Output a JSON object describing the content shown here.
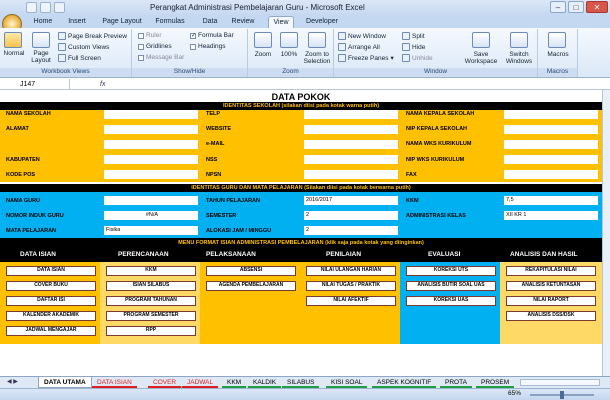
{
  "window": {
    "title": "Perangkat Administrasi Pembelajaran Guru  -  Microsoft Excel",
    "minimize": "–",
    "maximize": "□",
    "close": "✕"
  },
  "ribbon_tabs": [
    "Home",
    "Insert",
    "Page Layout",
    "Formulas",
    "Data",
    "Review",
    "View",
    "Developer"
  ],
  "active_tab": "View",
  "ribbon": {
    "workbook_views": {
      "label": "Workbook Views",
      "normal": "Normal",
      "page_layout": "Page Layout",
      "page_break": "Page Break Preview",
      "custom": "Custom Views",
      "full": "Full Screen"
    },
    "show_hide": {
      "label": "Show/Hide",
      "ruler": "Ruler",
      "gridlines": "Gridlines",
      "message_bar": "Message Bar",
      "formula_bar": "Formula Bar",
      "headings": "Headings"
    },
    "zoom": {
      "label": "Zoom",
      "zoom": "Zoom",
      "pct": "100%",
      "selection": "Zoom to Selection"
    },
    "window": {
      "label": "Window",
      "new_window": "New Window",
      "arrange_all": "Arrange All",
      "freeze": "Freeze Panes",
      "split": "Split",
      "hide": "Hide",
      "unhide": "Unhide",
      "save_ws": "Save Workspace",
      "switch": "Switch Windows"
    },
    "macros": {
      "label": "Macros",
      "macros": "Macros"
    }
  },
  "formula_bar": {
    "name_box": "J147",
    "fx": "fx"
  },
  "sheet": {
    "title": "DATA POKOK",
    "identitas_sekolah": "IDENTITAS SEKOLAH (silakan diisi pada kotak warna putih)",
    "school_fields": {
      "nama_sekolah": "NAMA SEKOLAH",
      "alamat": "ALAMAT",
      "kabupaten": "KABUPATEN",
      "kode_pos": "KODE POS",
      "telp": "TELP",
      "website": "WEBSITE",
      "email": "e-MAIL",
      "nss": "NSS",
      "npsn": "NPSN",
      "nama_kepala": "NAMA KEPALA SEKOLAH",
      "nip_kepala": "NIP KEPALA SEKOLAH",
      "nama_wks": "NAMA WKS KURIKULUM",
      "nip_wks": "NIP WKS KURIKULUM",
      "fax": "FAX"
    },
    "identitas_guru": "IDENTITAS GURU DAN MATA PELAJARAN (Silakan diisi pada kotak berwarna putih)",
    "guru_fields": {
      "nama_guru": "NAMA GURU",
      "nig": "NOMOR INDUK GURU",
      "nig_val": "#N/A",
      "mapel": "MATA PELAJARAN",
      "mapel_val": "Fisika",
      "tahun": "TAHUN PELAJARAN",
      "tahun_val": "2016/2017",
      "semester": "SEMESTER",
      "semester_val": "2",
      "alokasi": "ALOKASI JAM / MINGGU",
      "alokasi_val": "2",
      "kkm": "KKM",
      "kkm_val": "7,5",
      "kelas": "ADMINISTRASI KELAS",
      "kelas_val": "XII KR 1"
    },
    "menu_title": "MENU FORMAT ISIAN ADMINISTRASI PEMBELAJARAN (klik saja pada kotak yang diinginkan)",
    "columns": [
      {
        "header": "DATA ISIAN",
        "buttons": [
          "DATA ISIAN",
          "COVER BUKU",
          "DAFTAR ISI",
          "KALENDER AKADEMIK",
          "JADWAL MENGAJAR"
        ]
      },
      {
        "header": "PERENCANAAN",
        "buttons": [
          "KKM",
          "ISIAN SILABUS",
          "PROGRAM TAHUNAN",
          "PROGRAM SEMESTER",
          "RPP"
        ]
      },
      {
        "header": "PELAKSANAAN",
        "buttons": [
          "ABSENSI",
          "AGENDA PEMBELAJARAN"
        ]
      },
      {
        "header": "PENILAIAN",
        "buttons": [
          "NILAI ULANGAN HARIAN",
          "NILAI TUGAS / PRAKTIK",
          "NILAI AFEKTIF"
        ]
      },
      {
        "header": "EVALUASI",
        "buttons": [
          "KOREKSI UTS",
          "ANALISIS BUTIR SOAL UAS",
          "KOREKSI UAS"
        ]
      },
      {
        "header": "ANALISIS DAN HASIL",
        "buttons": [
          "REKAPITULASI NILAI",
          "ANALISIS KETUNTASAN",
          "NILAI RAPORT",
          "ANALISIS DSS/DSK"
        ]
      }
    ]
  },
  "sheet_tabs": [
    {
      "label": "DATA UTAMA",
      "active": true
    },
    {
      "label": "DATA ISIAN",
      "color": "#e02020"
    },
    {
      "label": "COVER",
      "color": "#e02020"
    },
    {
      "label": "JADWAL",
      "color": "#e02020"
    },
    {
      "label": "KKM",
      "color": "#20a040"
    },
    {
      "label": "KALDIK",
      "color": "#20a040"
    },
    {
      "label": "SILABUS",
      "color": "#20a040"
    },
    {
      "label": "KISI SOAL",
      "color": "#20a040"
    },
    {
      "label": "ASPEK KOGNITIF",
      "color": "#20a040"
    },
    {
      "label": "PROTA",
      "color": "#20a040"
    },
    {
      "label": "PROSEM",
      "color": "#20a040"
    }
  ],
  "status": {
    "zoom": "65%"
  },
  "colors": {
    "yellow": "#ffc000",
    "blue": "#00b0f0",
    "black": "#000000"
  }
}
